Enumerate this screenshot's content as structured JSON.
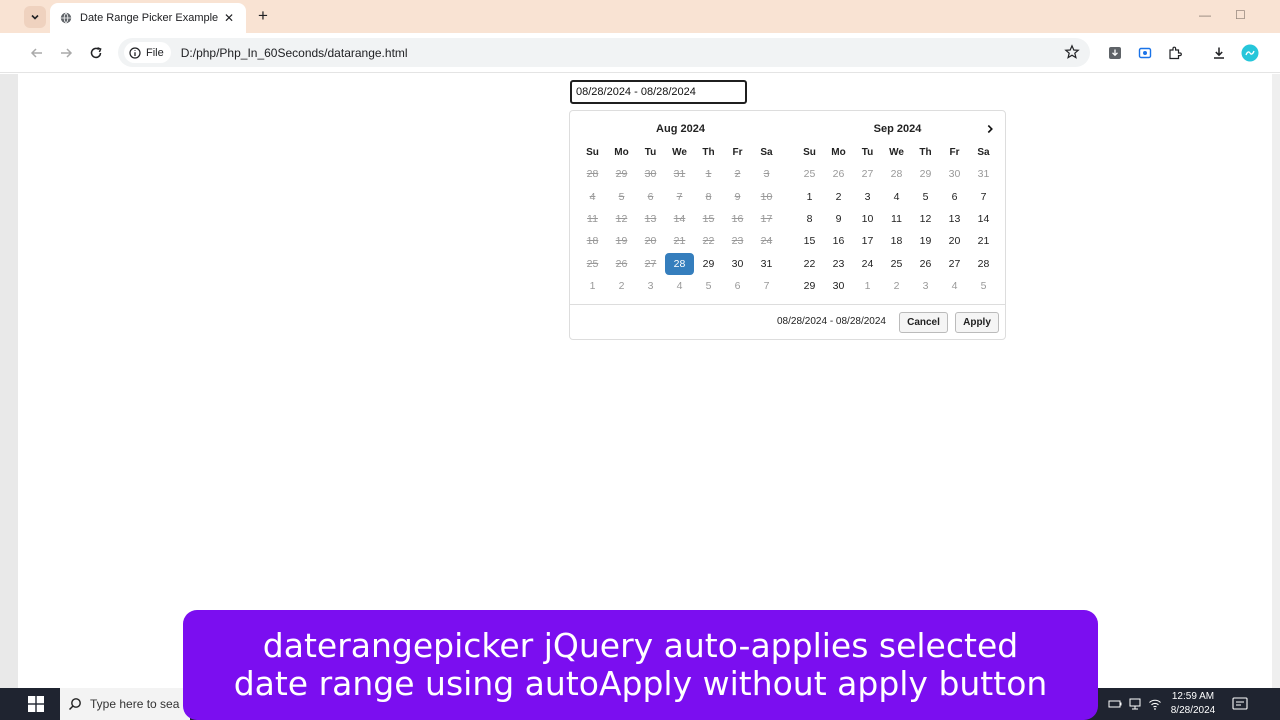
{
  "browser": {
    "tab_title": "Date Range Picker Example",
    "chip_label": "File",
    "url": "D:/php/Php_In_60Seconds/datarange.html"
  },
  "daterange": {
    "input_value": "08/28/2024 - 08/28/2024",
    "left": {
      "month": "Aug 2024",
      "weekdays": [
        "Su",
        "Mo",
        "Tu",
        "We",
        "Th",
        "Fr",
        "Sa"
      ],
      "weeks": [
        [
          "28",
          "29",
          "30",
          "31",
          "1",
          "2",
          "3"
        ],
        [
          "4",
          "5",
          "6",
          "7",
          "8",
          "9",
          "10"
        ],
        [
          "11",
          "12",
          "13",
          "14",
          "15",
          "16",
          "17"
        ],
        [
          "18",
          "19",
          "20",
          "21",
          "22",
          "23",
          "24"
        ],
        [
          "25",
          "26",
          "27",
          "28",
          "29",
          "30",
          "31"
        ],
        [
          "1",
          "2",
          "3",
          "4",
          "5",
          "6",
          "7"
        ]
      ]
    },
    "right": {
      "month": "Sep 2024",
      "weekdays": [
        "Su",
        "Mo",
        "Tu",
        "We",
        "Th",
        "Fr",
        "Sa"
      ],
      "weeks": [
        [
          "25",
          "26",
          "27",
          "28",
          "29",
          "30",
          "31"
        ],
        [
          "1",
          "2",
          "3",
          "4",
          "5",
          "6",
          "7"
        ],
        [
          "8",
          "9",
          "10",
          "11",
          "12",
          "13",
          "14"
        ],
        [
          "15",
          "16",
          "17",
          "18",
          "19",
          "20",
          "21"
        ],
        [
          "22",
          "23",
          "24",
          "25",
          "26",
          "27",
          "28"
        ],
        [
          "29",
          "30",
          "1",
          "2",
          "3",
          "4",
          "5"
        ]
      ]
    },
    "selected_range": "08/28/2024 - 08/28/2024",
    "cancel_label": "Cancel",
    "apply_label": "Apply",
    "active_color": "#357ebd"
  },
  "taskbar": {
    "search_placeholder": "Type here to sea",
    "time": "12:59 AM",
    "date": "8/28/2024"
  },
  "caption": {
    "line1": "daterangepicker jQuery auto-applies selected",
    "line2": "date range using autoApply without apply button"
  }
}
